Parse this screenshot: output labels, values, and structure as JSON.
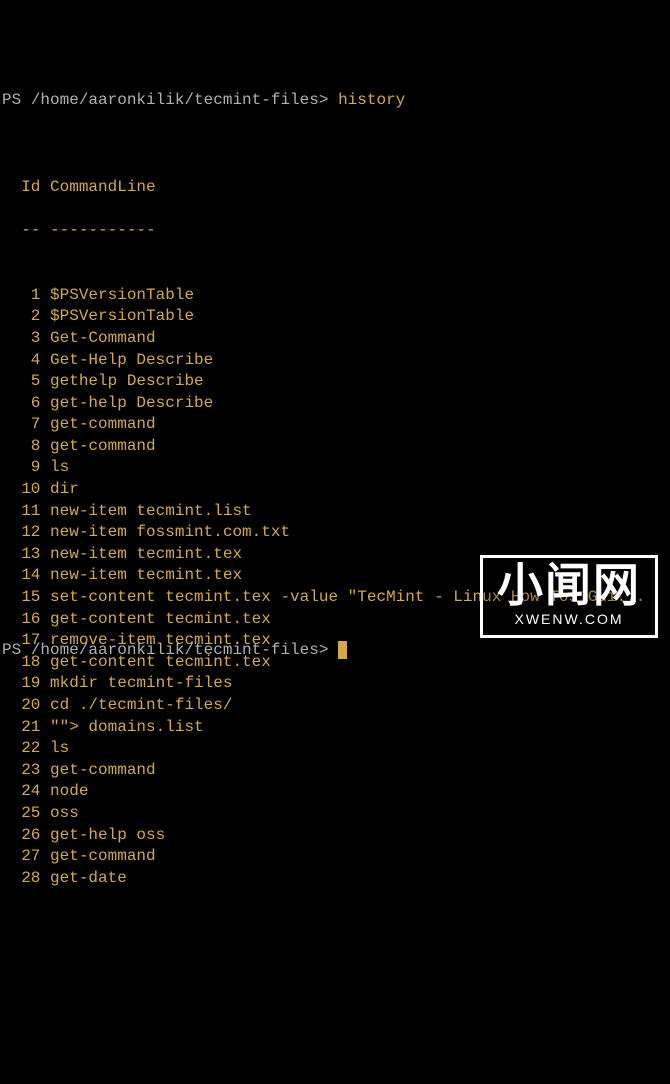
{
  "prompt1": {
    "prefix": "PS ",
    "path": "/home/aaronkilik/tecmint-files",
    "suffix": "> ",
    "command": "history"
  },
  "header": {
    "id_label": "Id",
    "cmd_label": "CommandLine",
    "sep_id": "--",
    "sep_cmd": "-----------"
  },
  "history": [
    {
      "id": "1",
      "cmd": "$PSVersionTable"
    },
    {
      "id": "2",
      "cmd": "$PSVersionTable"
    },
    {
      "id": "3",
      "cmd": "Get-Command"
    },
    {
      "id": "4",
      "cmd": "Get-Help Describe"
    },
    {
      "id": "5",
      "cmd": "gethelp Describe"
    },
    {
      "id": "6",
      "cmd": "get-help Describe"
    },
    {
      "id": "7",
      "cmd": "get-command"
    },
    {
      "id": "8",
      "cmd": "get-command"
    },
    {
      "id": "9",
      "cmd": "ls"
    },
    {
      "id": "10",
      "cmd": "dir"
    },
    {
      "id": "11",
      "cmd": "new-item tecmint.list"
    },
    {
      "id": "12",
      "cmd": "new-item fossmint.com.txt"
    },
    {
      "id": "13",
      "cmd": "new-item tecmint.tex"
    },
    {
      "id": "14",
      "cmd": "new-item tecmint.tex"
    },
    {
      "id": "15",
      "cmd": "set-content tecmint.tex -value \"TecMint - Linux How Tos Gui..."
    },
    {
      "id": "16",
      "cmd": "get-content tecmint.tex"
    },
    {
      "id": "17",
      "cmd": "remove-item tecmint.tex"
    },
    {
      "id": "18",
      "cmd": "get-content tecmint.tex"
    },
    {
      "id": "19",
      "cmd": "mkdir tecmint-files"
    },
    {
      "id": "20",
      "cmd": "cd ./tecmint-files/"
    },
    {
      "id": "21",
      "cmd": "\"\"> domains.list"
    },
    {
      "id": "22",
      "cmd": "ls"
    },
    {
      "id": "23",
      "cmd": "get-command"
    },
    {
      "id": "24",
      "cmd": "node"
    },
    {
      "id": "25",
      "cmd": "oss"
    },
    {
      "id": "26",
      "cmd": "get-help oss"
    },
    {
      "id": "27",
      "cmd": "get-command"
    },
    {
      "id": "28",
      "cmd": "get-date"
    }
  ],
  "prompt2": {
    "prefix": "PS ",
    "path": "/home/aaronkilik/tecmint-files",
    "suffix": "> "
  },
  "watermark": {
    "main": "小闻网",
    "sub": "XWENW.COM"
  }
}
